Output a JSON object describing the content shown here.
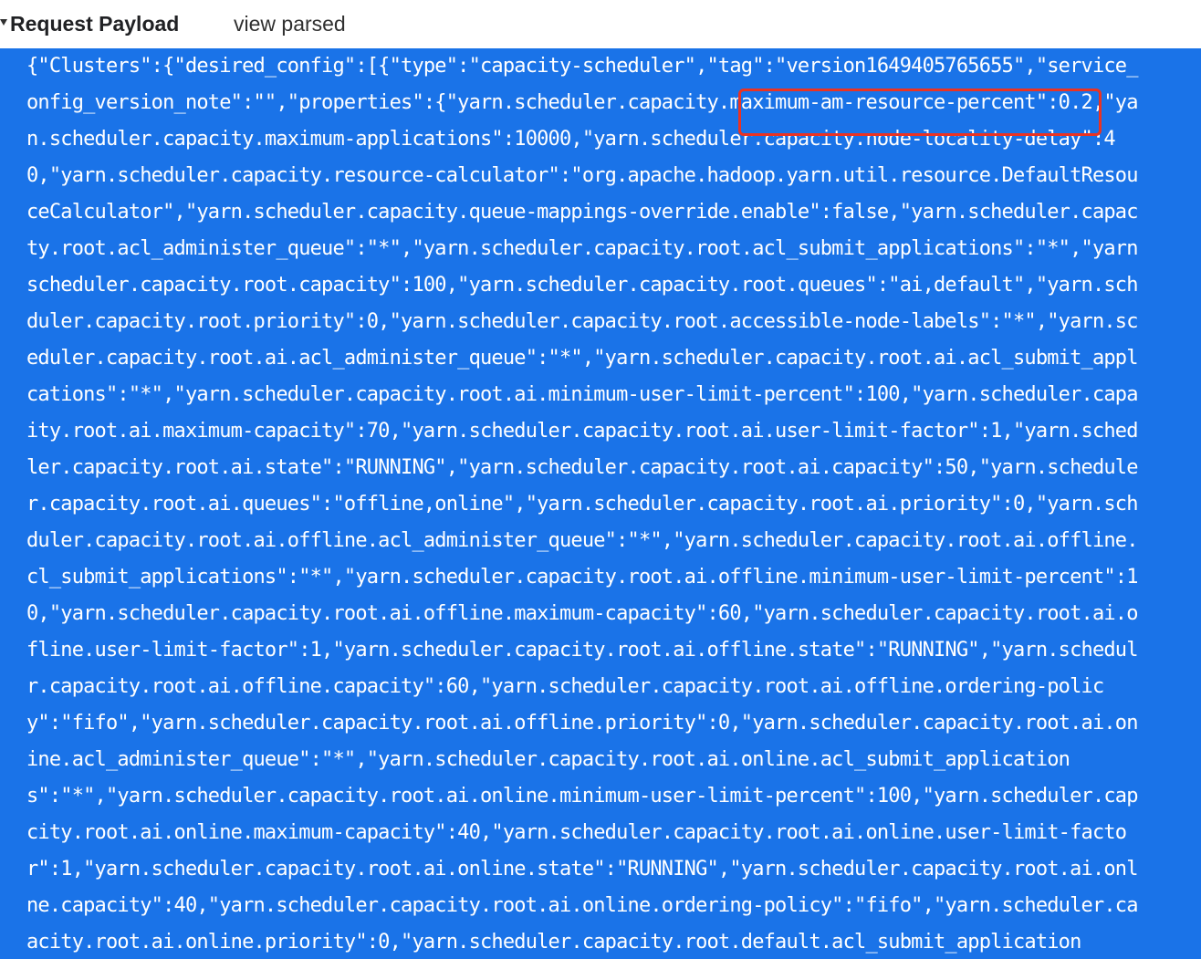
{
  "header": {
    "title": "Request Payload",
    "view_parsed_label": "view parsed"
  },
  "colors": {
    "selection_background": "#1a73e8",
    "payload_text": "#ffffff",
    "highlight_border": "#ea3323"
  },
  "icons": {
    "section_toggle": "caret-down-icon"
  },
  "payload": {
    "lines": [
      "{\"Clusters\":{\"desired_config\":[{\"type\":\"capacity-scheduler\",\"tag\":\"version1649405765655\",\"service_",
      "onfig_version_note\":\"\",\"properties\":{\"yarn.scheduler.capacity.maximum-am-resource-percent\":0.2,\"ya",
      "n.scheduler.capacity.maximum-applications\":10000,\"yarn.scheduler.capacity.node-locality-delay\":4",
      "0,\"yarn.scheduler.capacity.resource-calculator\":\"org.apache.hadoop.yarn.util.resource.DefaultResou",
      "ceCalculator\",\"yarn.scheduler.capacity.queue-mappings-override.enable\":false,\"yarn.scheduler.capac",
      "ty.root.acl_administer_queue\":\"*\",\"yarn.scheduler.capacity.root.acl_submit_applications\":\"*\",\"yarn",
      "scheduler.capacity.root.capacity\":100,\"yarn.scheduler.capacity.root.queues\":\"ai,default\",\"yarn.sch",
      "duler.capacity.root.priority\":0,\"yarn.scheduler.capacity.root.accessible-node-labels\":\"*\",\"yarn.sc",
      "eduler.capacity.root.ai.acl_administer_queue\":\"*\",\"yarn.scheduler.capacity.root.ai.acl_submit_appl",
      "cations\":\"*\",\"yarn.scheduler.capacity.root.ai.minimum-user-limit-percent\":100,\"yarn.scheduler.capa",
      "ity.root.ai.maximum-capacity\":70,\"yarn.scheduler.capacity.root.ai.user-limit-factor\":1,\"yarn.sched",
      "ler.capacity.root.ai.state\":\"RUNNING\",\"yarn.scheduler.capacity.root.ai.capacity\":50,\"yarn.schedule",
      "r.capacity.root.ai.queues\":\"offline,online\",\"yarn.scheduler.capacity.root.ai.priority\":0,\"yarn.sch",
      "duler.capacity.root.ai.offline.acl_administer_queue\":\"*\",\"yarn.scheduler.capacity.root.ai.offline.",
      "cl_submit_applications\":\"*\",\"yarn.scheduler.capacity.root.ai.offline.minimum-user-limit-percent\":1",
      "0,\"yarn.scheduler.capacity.root.ai.offline.maximum-capacity\":60,\"yarn.scheduler.capacity.root.ai.o",
      "fline.user-limit-factor\":1,\"yarn.scheduler.capacity.root.ai.offline.state\":\"RUNNING\",\"yarn.schedul",
      "r.capacity.root.ai.offline.capacity\":60,\"yarn.scheduler.capacity.root.ai.offline.ordering-polic",
      "y\":\"fifo\",\"yarn.scheduler.capacity.root.ai.offline.priority\":0,\"yarn.scheduler.capacity.root.ai.on",
      "ine.acl_administer_queue\":\"*\",\"yarn.scheduler.capacity.root.ai.online.acl_submit_application",
      "s\":\"*\",\"yarn.scheduler.capacity.root.ai.online.minimum-user-limit-percent\":100,\"yarn.scheduler.cap",
      "city.root.ai.online.maximum-capacity\":40,\"yarn.scheduler.capacity.root.ai.online.user-limit-facto",
      "r\":1,\"yarn.scheduler.capacity.root.ai.online.state\":\"RUNNING\",\"yarn.scheduler.capacity.root.ai.onl",
      "ne.capacity\":40,\"yarn.scheduler.capacity.root.ai.online.ordering-policy\":\"fifo\",\"yarn.scheduler.ca",
      "acity.root.ai.online.priority\":0,\"yarn.scheduler.capacity.root.default.acl_submit_application"
    ]
  }
}
